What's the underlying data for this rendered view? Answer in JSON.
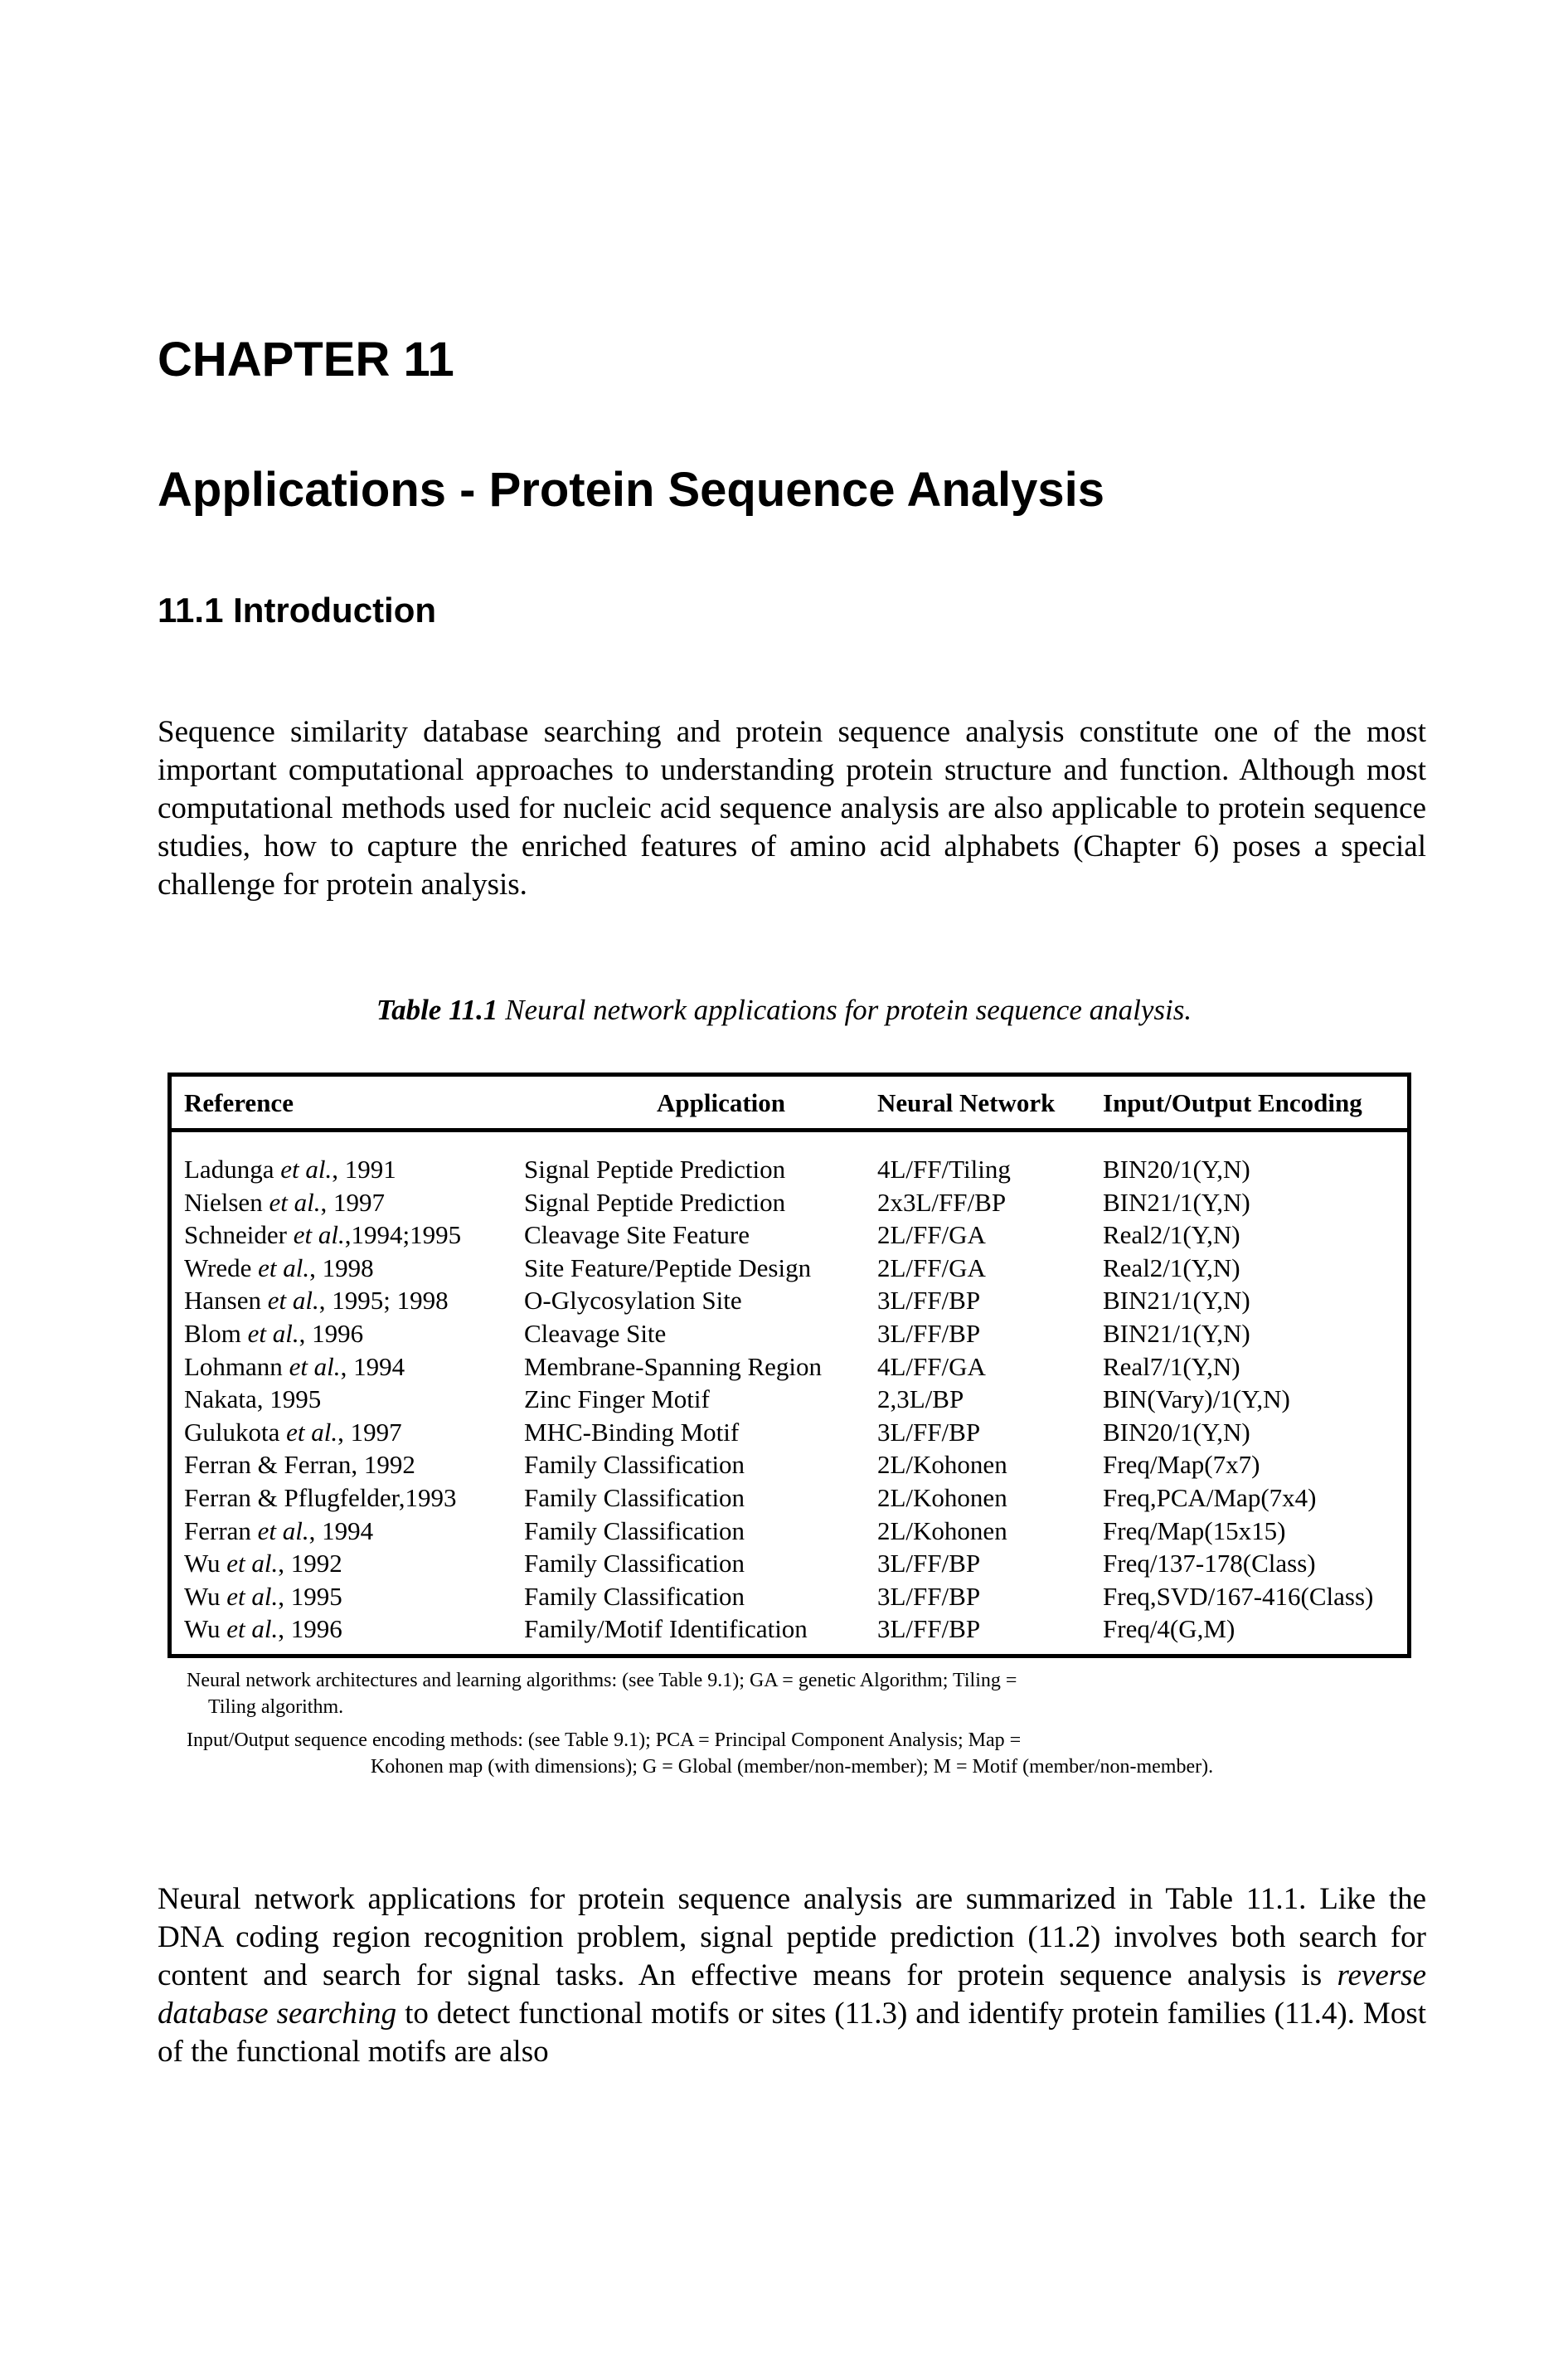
{
  "chapter_label": "CHAPTER 11",
  "chapter_title": "Applications - Protein Sequence Analysis",
  "section_heading": "11.1 Introduction",
  "paragraph_1": "Sequence similarity database searching and protein sequence analysis constitute one of the most important computational approaches to understanding protein structure and function.  Although most computational methods used for nucleic acid sequence analysis are also applicable to protein sequence studies, how to capture the enriched features of amino acid alphabets (Chapter 6) poses a special challenge for protein analysis.",
  "table": {
    "caption_label": "Table 11.1",
    "caption_text": " Neural network applications for protein sequence analysis.",
    "headers": {
      "reference": "Reference",
      "application": "Application",
      "neural_network": "Neural Network",
      "encoding": "Input/Output Encoding"
    },
    "rows": [
      {
        "author": "Ladunga",
        "etal": " et al.",
        "year": ", 1991",
        "application": "Signal Peptide Prediction",
        "network": "4L/FF/Tiling",
        "encoding": "BIN20/1(Y,N)"
      },
      {
        "author": "Nielsen",
        "etal": " et al.",
        "year": ", 1997",
        "application": "Signal Peptide Prediction",
        "network": "2x3L/FF/BP",
        "encoding": "BIN21/1(Y,N)"
      },
      {
        "author": "Schneider",
        "etal": " et al.",
        "year": ",1994;1995",
        "application": "Cleavage Site Feature",
        "network": "2L/FF/GA",
        "encoding": "Real2/1(Y,N)"
      },
      {
        "author": "Wrede",
        "etal": " et al.",
        "year": ", 1998",
        "application": "Site Feature/Peptide Design",
        "network": "2L/FF/GA",
        "encoding": "Real2/1(Y,N)"
      },
      {
        "author": "Hansen",
        "etal": " et al.",
        "year": ", 1995; 1998",
        "application": "O-Glycosylation Site",
        "network": "3L/FF/BP",
        "encoding": "BIN21/1(Y,N)"
      },
      {
        "author": "Blom",
        "etal": " et al.",
        "year": ", 1996",
        "application": "Cleavage Site",
        "network": "3L/FF/BP",
        "encoding": "BIN21/1(Y,N)"
      },
      {
        "author": "Lohmann",
        "etal": " et al.",
        "year": ", 1994",
        "application": "Membrane-Spanning Region",
        "network": "4L/FF/GA",
        "encoding": "Real7/1(Y,N)"
      },
      {
        "author": "Nakata, 1995",
        "etal": "",
        "year": "",
        "application": "Zinc Finger Motif",
        "network": "2,3L/BP",
        "encoding": "BIN(Vary)/1(Y,N)"
      },
      {
        "author": "Gulukota",
        "etal": " et al.",
        "year": ", 1997",
        "application": "MHC-Binding Motif",
        "network": "3L/FF/BP",
        "encoding": "BIN20/1(Y,N)"
      },
      {
        "author": "Ferran & Ferran, 1992",
        "etal": "",
        "year": "",
        "application": "Family Classification",
        "network": "2L/Kohonen",
        "encoding": "Freq/Map(7x7)"
      },
      {
        "author": "Ferran & Pflugfelder,1993",
        "etal": "",
        "year": "",
        "application": "Family Classification",
        "network": "2L/Kohonen",
        "encoding": "Freq,PCA/Map(7x4)"
      },
      {
        "author": "Ferran",
        "etal": " et al.",
        "year": ", 1994",
        "application": "Family Classification",
        "network": "2L/Kohonen",
        "encoding": "Freq/Map(15x15)"
      },
      {
        "author": "Wu",
        "etal": " et al.",
        "year": ", 1992",
        "application": "Family Classification",
        "network": "3L/FF/BP",
        "encoding": "Freq/137-178(Class)"
      },
      {
        "author": "Wu",
        "etal": " et al.",
        "year": ", 1995",
        "application": "Family Classification",
        "network": "3L/FF/BP",
        "encoding": "Freq,SVD/167-416(Class)"
      },
      {
        "author": "Wu",
        "etal": " et al.",
        "year": ", 1996",
        "application": "Family/Motif Identification",
        "network": "3L/FF/BP",
        "encoding": "Freq/4(G,M)"
      }
    ],
    "footnote_1_line1": "Neural network architectures and learning algorithms: (see Table 9.1); GA = genetic Algorithm; Tiling =",
    "footnote_1_line2": "Tiling algorithm.",
    "footnote_2_line1": "Input/Output sequence encoding methods: (see Table 9.1); PCA = Principal Component Analysis; Map =",
    "footnote_2_line2": "Kohonen map (with dimensions); G = Global (member/non-member); M = Motif (member/non-member)."
  },
  "paragraph_2": {
    "part1": "Neural network applications for protein sequence analysis are summarized in Table 11.1. Like the DNA coding region recognition problem, signal peptide prediction (11.2) involves both search for content and search for signal tasks.  An effective means for protein sequence analysis is ",
    "emphasis": "reverse database searching",
    "part2": " to detect functional motifs or sites (11.3) and identify protein families (11.4).  Most of the functional motifs are also"
  }
}
